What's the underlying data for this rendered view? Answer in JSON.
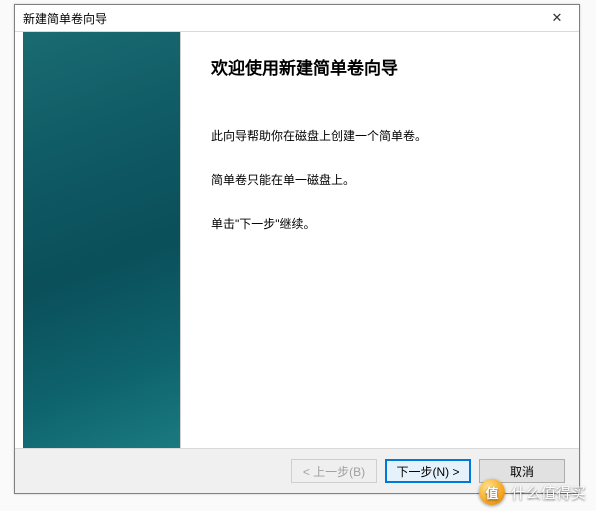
{
  "dialog": {
    "title": "新建简单卷向导",
    "close_glyph": "✕",
    "heading": "欢迎使用新建简单卷向导",
    "para1": "此向导帮助你在磁盘上创建一个简单卷。",
    "para2": "简单卷只能在单一磁盘上。",
    "para3": "单击\"下一步\"继续。",
    "buttons": {
      "back": "< 上一步(B)",
      "next": "下一步(N) >",
      "cancel": "取消"
    }
  },
  "watermark": {
    "badge": "值",
    "text": "什么值得买"
  }
}
